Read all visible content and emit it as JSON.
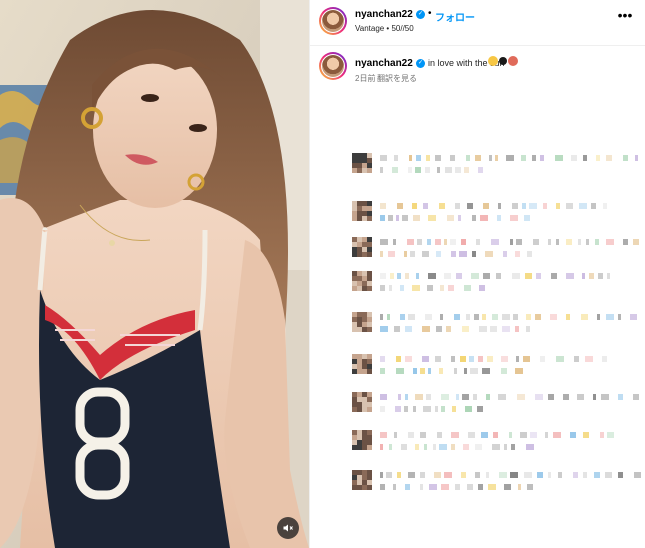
{
  "post": {
    "username": "nyanchan22",
    "verified_mark": "✓",
    "separator": "•",
    "follow_label": "フォロー",
    "audio_label": "Vantage • 50//50",
    "more_icon": "more-horizontal-icon"
  },
  "caption": {
    "username": "nyanchan22",
    "verified_mark": "✓",
    "text": "in love with the sun",
    "emojis": [
      "smiling-face-emoji",
      "black-heart-emoji",
      "sun-hat-emoji"
    ],
    "time_ago": "2日前",
    "translate_label": "翻訳を見る"
  },
  "media": {
    "mute_icon": "speaker-muted-icon",
    "accent": "#0095f6"
  },
  "comments_note": "Comments are pixelated/blurred in the screenshot; shown as mosaic placeholders."
}
